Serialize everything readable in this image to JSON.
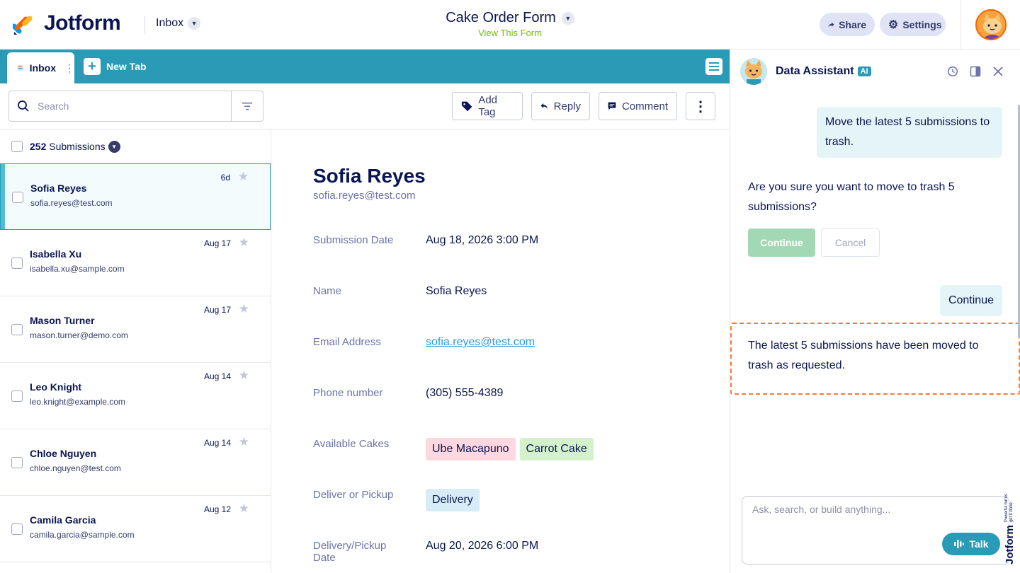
{
  "header": {
    "brand": "Jotform",
    "inbox_label": "Inbox",
    "form_title": "Cake Order Form",
    "view_form": "View This Form",
    "share": "Share",
    "settings": "Settings"
  },
  "tabs": {
    "inbox": "Inbox",
    "new_tab": "New Tab"
  },
  "toolbar": {
    "search_placeholder": "Search",
    "add_tag": "Add Tag",
    "reply": "Reply",
    "comment": "Comment"
  },
  "list": {
    "count": "252",
    "count_label": "Submissions",
    "rows": [
      {
        "name": "Sofia Reyes",
        "email": "sofia.reyes@test.com",
        "date": "6d"
      },
      {
        "name": "Isabella Xu",
        "email": "isabella.xu@sample.com",
        "date": "Aug 17"
      },
      {
        "name": "Mason Turner",
        "email": "mason.turner@demo.com",
        "date": "Aug 17"
      },
      {
        "name": "Leo Knight",
        "email": "leo.knight@example.com",
        "date": "Aug 14"
      },
      {
        "name": "Chloe Nguyen",
        "email": "chloe.nguyen@test.com",
        "date": "Aug 14"
      },
      {
        "name": "Camila Garcia",
        "email": "camila.garcia@sample.com",
        "date": "Aug 12"
      }
    ]
  },
  "detail": {
    "name": "Sofia Reyes",
    "email": "sofia.reyes@test.com",
    "fields": {
      "submission_date_label": "Submission Date",
      "submission_date": "Aug 18, 2026 3:00 PM",
      "name_label": "Name",
      "name": "Sofia Reyes",
      "email_label": "Email Address",
      "email": "sofia.reyes@test.com",
      "phone_label": "Phone number",
      "phone": "(305) 555-4389",
      "cakes_label": "Available Cakes",
      "cake_1": "Ube Macapuno",
      "cake_2": "Carrot Cake",
      "deliver_label": "Deliver or Pickup",
      "deliver": "Delivery",
      "pickup_date_label": "Delivery/Pickup Date",
      "pickup_date": "Aug 20, 2026 6:00 PM"
    }
  },
  "assistant": {
    "title": "Data Assistant",
    "badge": "AI",
    "msg_user_1": "Move the latest 5 submissions to trash.",
    "msg_bot_1": "Are you sure you want to move to trash 5 submissions?",
    "continue_btn": "Continue",
    "cancel_btn": "Cancel",
    "msg_user_2": "Continue",
    "msg_bot_2": "The latest 5 submissions have been moved to trash as requested.",
    "input_placeholder": "Ask, search, or build anything...",
    "talk": "Talk",
    "side_brand": "Jotform",
    "side_tagline": "Powerful forms get it done"
  },
  "colors": {
    "teal": "#2a9bb7",
    "navy": "#0a1551",
    "highlight_border": "#ff7a2f",
    "continue_green": "#a2d9b4"
  }
}
